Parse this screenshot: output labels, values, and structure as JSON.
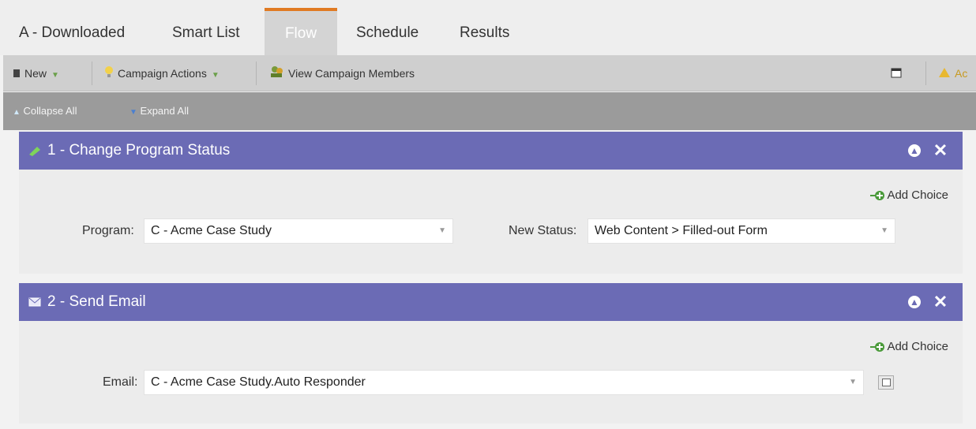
{
  "tabs": [
    {
      "label": "A - Downloaded"
    },
    {
      "label": "Smart List"
    },
    {
      "label": "Flow"
    },
    {
      "label": "Schedule"
    },
    {
      "label": "Results"
    }
  ],
  "toolbar": {
    "new_label": "New",
    "campaign_actions_label": "Campaign Actions",
    "view_members_label": "View Campaign Members",
    "right_label": "Ac"
  },
  "subbar": {
    "collapse_label": "Collapse All",
    "expand_label": "Expand All"
  },
  "steps": [
    {
      "title": "1 - Change Program Status",
      "add_choice": "Add Choice",
      "fields": [
        {
          "label": "Program:",
          "value": "C - Acme Case Study"
        },
        {
          "label": "New Status:",
          "value": "Web Content > Filled-out Form"
        }
      ]
    },
    {
      "title": "2 - Send Email",
      "add_choice": "Add Choice",
      "fields": [
        {
          "label": "Email:",
          "value": "C - Acme Case Study.Auto Responder"
        }
      ]
    }
  ],
  "colors": {
    "step_header": "#6b6bb5",
    "active_tab_accent": "#e07a22",
    "toolbar_bg": "#cfcfcf",
    "subbar_bg": "#9b9b9b"
  },
  "icons": [
    "new-icon",
    "bulb-icon",
    "members-icon",
    "calendar-icon",
    "warning-icon",
    "collapse-icon",
    "expand-icon",
    "status-icon",
    "email-icon",
    "add-choice-icon",
    "move-up-icon",
    "close-icon",
    "lookup-icon"
  ]
}
